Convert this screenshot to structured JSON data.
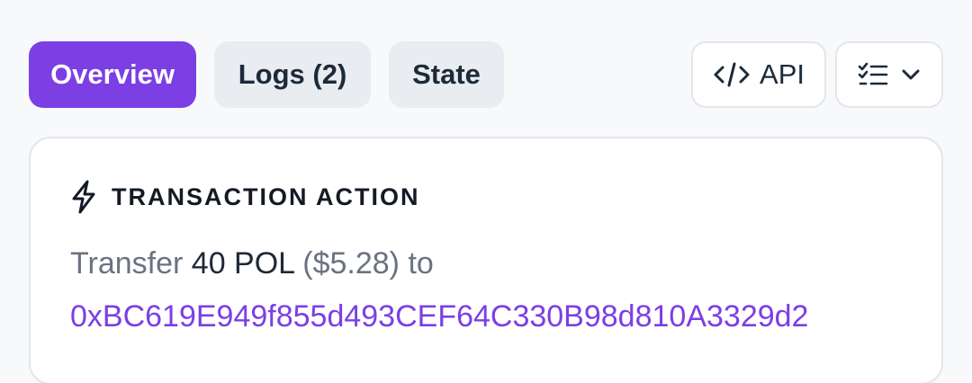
{
  "tabs": [
    {
      "label": "Overview",
      "active": true
    },
    {
      "label": "Logs (2)",
      "active": false
    },
    {
      "label": "State",
      "active": false
    }
  ],
  "actions": {
    "api_label": "API",
    "api_icon": "code-icon",
    "menu_icon": "checklist-icon",
    "menu_caret_icon": "chevron-down-icon"
  },
  "card": {
    "icon": "lightning-icon",
    "title": "TRANSACTION ACTION",
    "summary": {
      "verb": "Transfer",
      "amount": "40 POL",
      "usd": "($5.28)",
      "to": "to"
    },
    "address": "0xBC619E949f855d493CEF64C330B98d810A3329d2"
  },
  "colors": {
    "accent": "#7b3fe4",
    "tab_inactive_bg": "#e9ecf0",
    "text_dark": "#1d2a3a",
    "text_muted": "#6b7280",
    "page_bg": "#f8f9fb"
  }
}
